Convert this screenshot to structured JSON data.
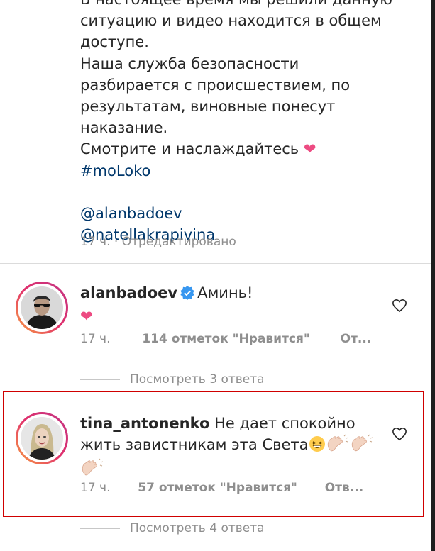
{
  "post": {
    "caption_lines": [
      "В настоящее время мы решили данную",
      "ситуацию и видео находится в общем",
      "доступе.",
      "Наша служба безопасности",
      "разбирается с происшествием,  по",
      "результатам,  виновные понесут",
      "наказание.",
      "Смотрите и наслаждайтесь"
    ],
    "hashtag": "#moLoko",
    "mentions": [
      "@alanbadoev",
      "@natellakrapivina"
    ],
    "meta": "17 ч. · Отредактировано"
  },
  "comments": [
    {
      "username": "alanbadoev",
      "verified": true,
      "text": "Аминь!",
      "time": "17 ч.",
      "likes": "114 отметок \"Нравится\"",
      "reply": "От...",
      "view_replies": "Посмотреть 3 ответа",
      "avatar_icon": "man-with-sunglasses-avatar"
    },
    {
      "username": "tina_antonenko",
      "verified": false,
      "text_line1": "Не дает спокойно",
      "text_line2": "жить завистникам эта Света",
      "time": "17 ч.",
      "likes": "57 отметок \"Нравится\"",
      "reply": "Отв...",
      "view_replies": "Посмотреть 4 ответа",
      "avatar_icon": "woman-portrait-avatar"
    }
  ],
  "colors": {
    "text": "#262626",
    "secondary": "#8e8e8e",
    "link": "#00376b",
    "heart": "#ed4b82",
    "verified": "#3897f0",
    "highlight_border": "#d00000"
  },
  "icons": {
    "heart_emoji": "pink-heart-icon",
    "like": "heart-outline-icon",
    "verified": "verified-badge-icon",
    "laughing": "grinning-squinting-face-icon",
    "clap": "clapping-hands-icon"
  }
}
